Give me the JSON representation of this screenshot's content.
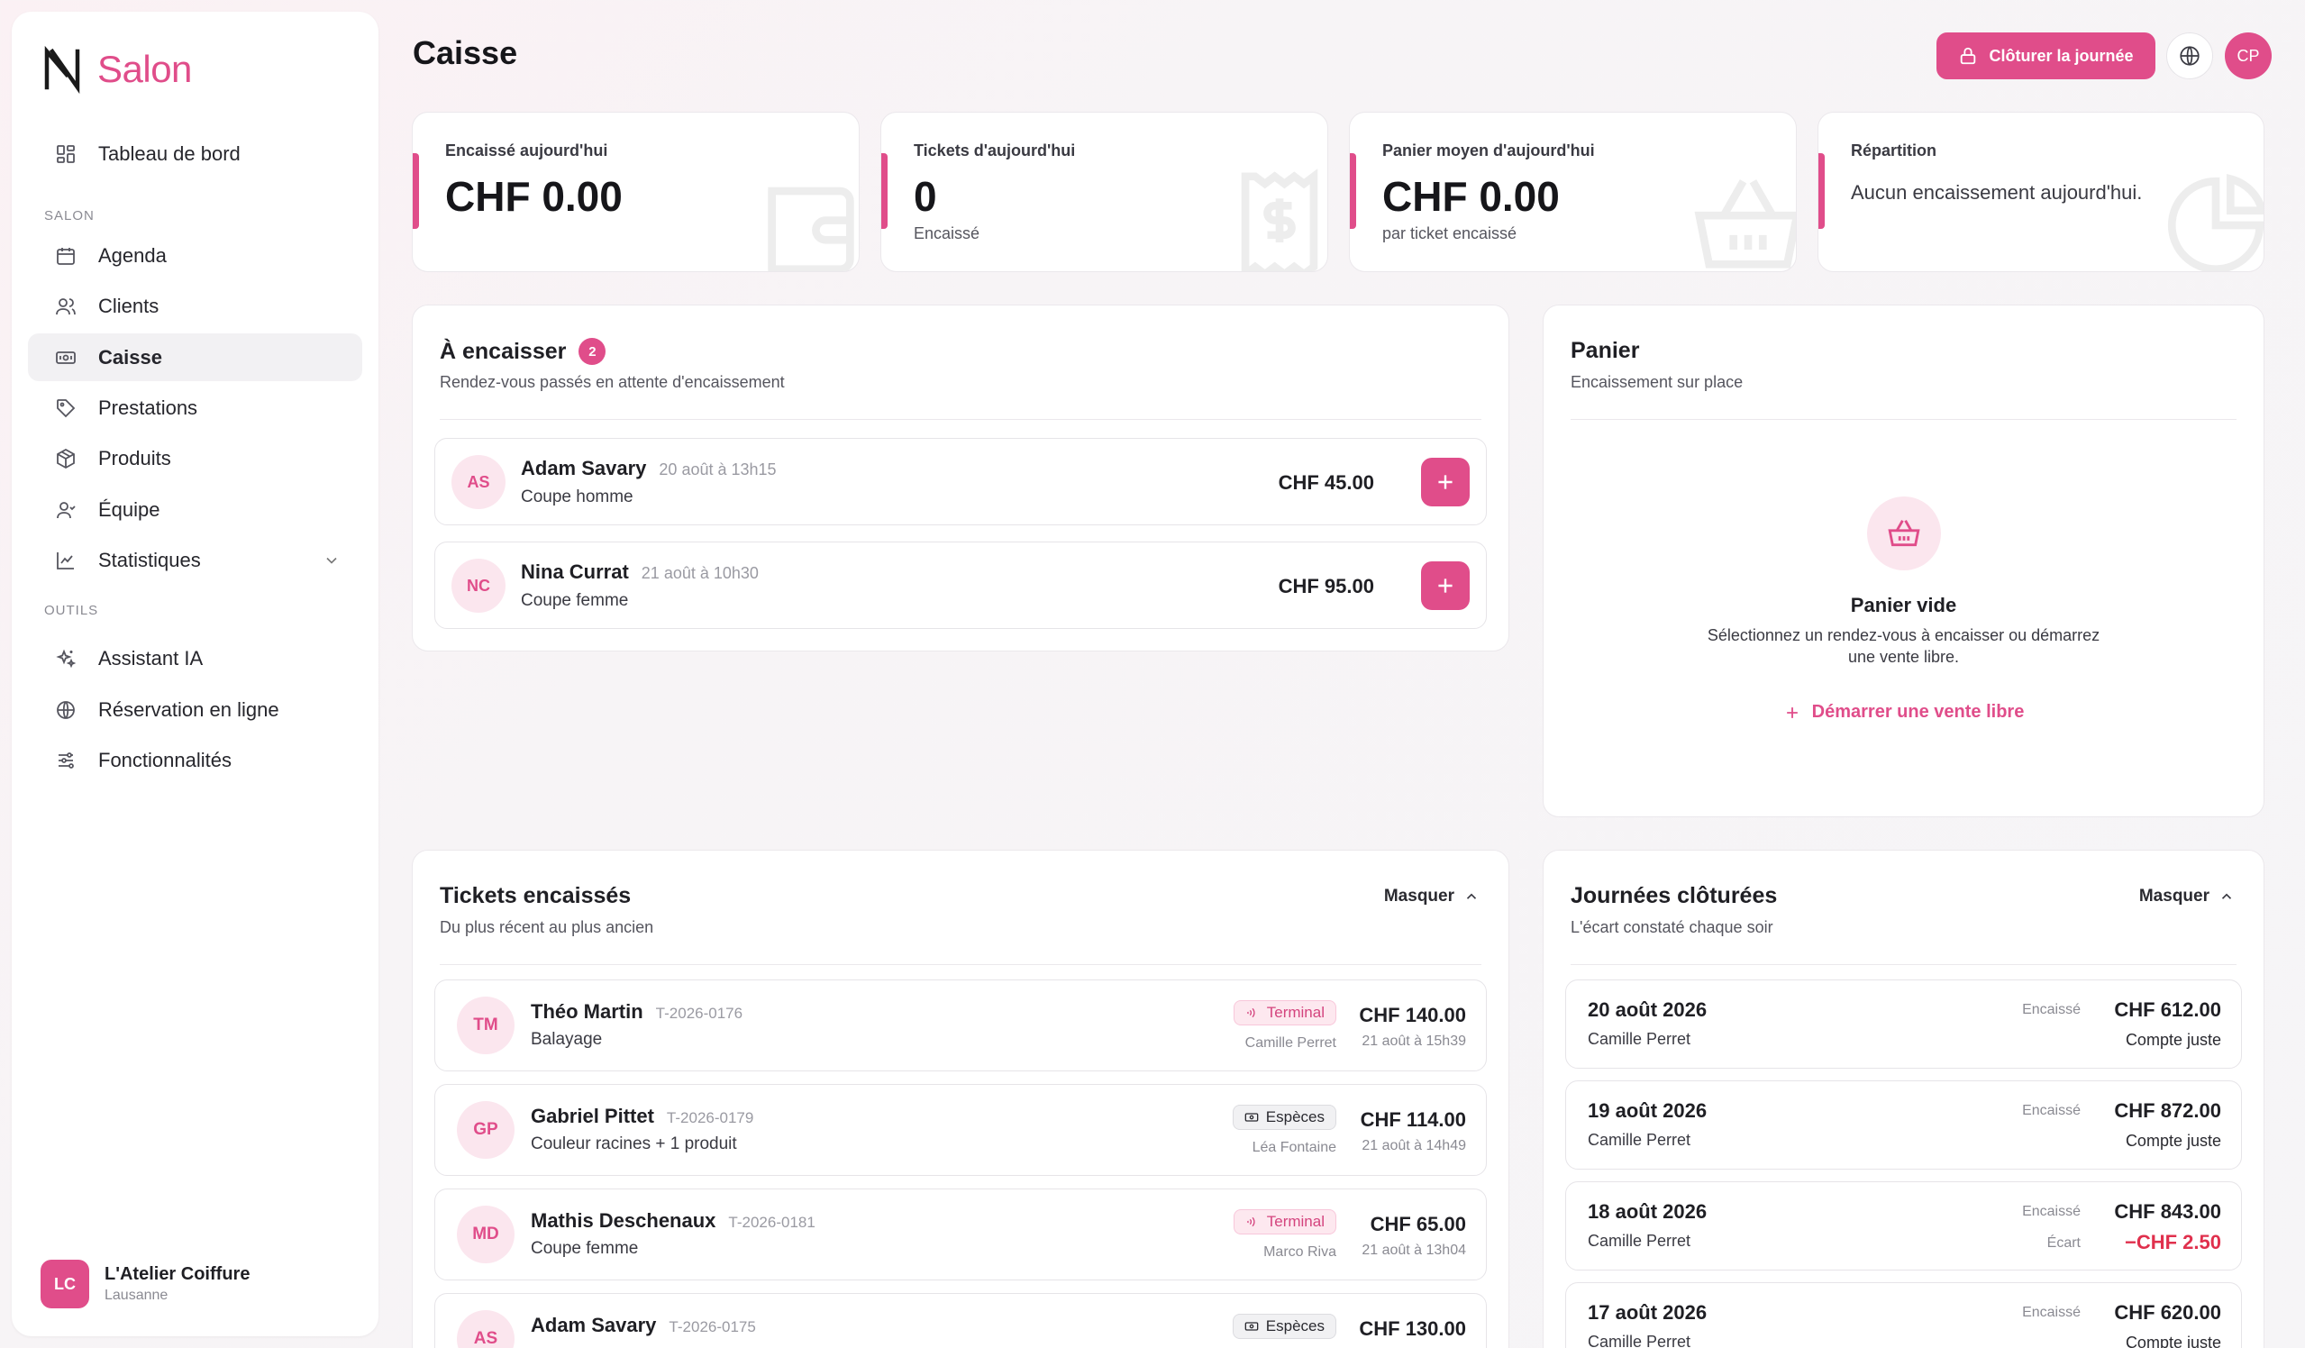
{
  "brand": {
    "name": "Salon",
    "logo_icon": "n-logo-icon",
    "accent": "#e04d8a"
  },
  "sidebar": {
    "top_item": {
      "label": "Tableau de bord",
      "icon": "dashboard-icon"
    },
    "section_salon": "SALON",
    "salon_items": [
      {
        "label": "Agenda",
        "icon": "calendar-icon"
      },
      {
        "label": "Clients",
        "icon": "users-icon"
      },
      {
        "label": "Caisse",
        "icon": "cash-icon",
        "active": true
      },
      {
        "label": "Prestations",
        "icon": "tag-icon"
      },
      {
        "label": "Produits",
        "icon": "box-icon"
      },
      {
        "label": "Équipe",
        "icon": "team-icon"
      },
      {
        "label": "Statistiques",
        "icon": "chart-icon"
      }
    ],
    "section_tools": "OUTILS",
    "tool_items": [
      {
        "label": "Assistant IA",
        "icon": "sparkles-icon"
      },
      {
        "label": "Réservation en ligne",
        "icon": "globe-icon"
      },
      {
        "label": "Fonctionnalités",
        "icon": "sliders-icon"
      }
    ],
    "org": {
      "initials": "LC",
      "name": "L'Atelier Coiffure",
      "city": "Lausanne"
    }
  },
  "header": {
    "title": "Caisse",
    "close_day_label": "Clôturer la journée",
    "user_initials": "CP"
  },
  "stats": [
    {
      "label": "Encaissé aujourd'hui",
      "value": "CHF 0.00",
      "icon": "wallet-icon"
    },
    {
      "label": "Tickets d'aujourd'hui",
      "value": "0",
      "sub": "Encaissé",
      "icon": "receipt-icon"
    },
    {
      "label": "Panier moyen d'aujourd'hui",
      "value": "CHF 0.00",
      "sub": "par ticket encaissé",
      "icon": "basket-icon"
    },
    {
      "label": "Répartition",
      "text": "Aucun encaissement aujourd'hui.",
      "icon": "pie-icon"
    }
  ],
  "to_collect": {
    "title": "À encaisser",
    "count": "2",
    "subtitle": "Rendez-vous passés en attente d'encaissement",
    "rows": [
      {
        "initials": "AS",
        "name": "Adam Savary",
        "when": "20 août à 13h15",
        "service": "Coupe homme",
        "amount": "CHF 45.00"
      },
      {
        "initials": "NC",
        "name": "Nina Currat",
        "when": "21 août à 10h30",
        "service": "Coupe femme",
        "amount": "CHF 95.00"
      }
    ]
  },
  "cart": {
    "title": "Panier",
    "subtitle": "Encaissement sur place",
    "empty_title": "Panier vide",
    "empty_line1": "Sélectionnez un rendez-vous à encaisser ou démarrez",
    "empty_line2": "une vente libre.",
    "start_label": "Démarrer une vente libre"
  },
  "tickets": {
    "title": "Tickets encaissés",
    "subtitle": "Du plus récent au plus ancien",
    "hide_label": "Masquer",
    "rows": [
      {
        "initials": "TM",
        "name": "Théo Martin",
        "ref": "T-2026-0176",
        "service": "Balayage",
        "method": "Terminal",
        "amount": "CHF 140.00",
        "staff": "Camille Perret",
        "time": "21 août à 15h39"
      },
      {
        "initials": "GP",
        "name": "Gabriel Pittet",
        "ref": "T-2026-0179",
        "service": "Couleur racines + 1 produit",
        "method": "Espèces",
        "amount": "CHF 114.00",
        "staff": "Léa Fontaine",
        "time": "21 août à 14h49"
      },
      {
        "initials": "MD",
        "name": "Mathis Deschenaux",
        "ref": "T-2026-0181",
        "service": "Coupe femme",
        "method": "Terminal",
        "amount": "CHF 65.00",
        "staff": "Marco Riva",
        "time": "21 août à 13h04"
      },
      {
        "initials": "AS",
        "name": "Adam Savary",
        "ref": "T-2026-0175",
        "service": "",
        "method": "Espèces",
        "amount": "CHF 130.00",
        "staff": "",
        "time": ""
      }
    ]
  },
  "closed_days": {
    "title": "Journées clôturées",
    "subtitle": "L'écart constaté chaque soir",
    "hide_label": "Masquer",
    "rows": [
      {
        "date": "20 août 2026",
        "staff": "Camille Perret",
        "label": "Encaissé",
        "amount": "CHF 612.00",
        "status": "Compte juste"
      },
      {
        "date": "19 août 2026",
        "staff": "Camille Perret",
        "label": "Encaissé",
        "amount": "CHF 872.00",
        "status": "Compte juste"
      },
      {
        "date": "18 août 2026",
        "staff": "Camille Perret",
        "label": "Encaissé",
        "amount": "CHF 843.00",
        "gap_label": "Écart",
        "status": "−CHF 2.50"
      },
      {
        "date": "17 août 2026",
        "staff": "Camille Perret",
        "label": "Encaissé",
        "amount": "CHF 620.00",
        "status": "Compte juste"
      }
    ]
  }
}
